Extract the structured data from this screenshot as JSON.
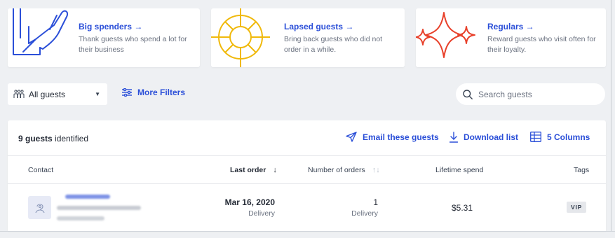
{
  "segments": [
    {
      "title": "Big spenders →",
      "description": "Thank guests who spend a lot for their business",
      "icon": "hand-icon"
    },
    {
      "title": "Lapsed guests →",
      "description": "Bring back guests who did not order in a while.",
      "icon": "sun-icon"
    },
    {
      "title": "Regulars →",
      "description": "Reward guests who visit often for their loyalty.",
      "icon": "sparkle-icon"
    }
  ],
  "filters": {
    "audience_label": "All guests",
    "more_filters_label": "More Filters",
    "search_placeholder": "Search guests"
  },
  "summary": {
    "count": "9 guests",
    "count_suffix": "identified"
  },
  "actions": {
    "email_label": "Email these guests",
    "download_label": "Download list",
    "columns_label": "5 Columns"
  },
  "columns": {
    "contact": "Contact",
    "last_order": "Last order",
    "last_order_arrow": "↓",
    "number_of_orders": "Number of orders",
    "number_of_orders_sort": "↑↓",
    "lifetime_spend": "Lifetime spend",
    "tags": "Tags"
  },
  "rows": [
    {
      "last_order_date": "Mar 16, 2020",
      "last_order_type": "Delivery",
      "orders": "1",
      "orders_type": "Delivery",
      "lifetime_spend": "$5.31",
      "tag": "VIP"
    }
  ],
  "colors": {
    "accent": "#2b4fd8",
    "hand_icon": "#2b4fd8",
    "sun_icon": "#f0b90b",
    "sparkle_icon": "#e8412b"
  }
}
